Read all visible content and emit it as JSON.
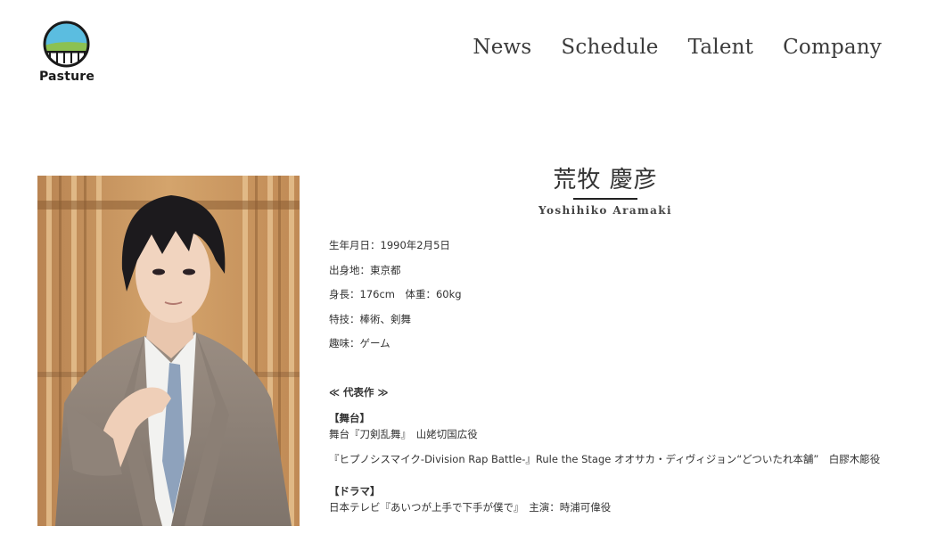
{
  "header": {
    "logo_text": "Pasture",
    "nav": [
      "News",
      "Schedule",
      "Talent",
      "Company"
    ]
  },
  "talent": {
    "name_ja": "荒牧 慶彦",
    "name_en": "Yoshihiko Aramaki"
  },
  "profile": {
    "rows": [
      "生年月日：1990年2月5日",
      "出身地：東京都",
      "身長：176cm　体重：60kg",
      "特技：棒術、剣舞",
      "趣味：ゲーム"
    ]
  },
  "works": {
    "heading": "≪ 代表作 ≫",
    "categories": [
      {
        "title": "【舞台】",
        "items": [
          "舞台『刀剣乱舞』　山姥切国広役",
          "『ヒプノシスマイク-Division Rap Battle-』Rule the Stage オオサカ・ディヴィジョン“どついたれ本舗”　白膠木簓役"
        ]
      },
      {
        "title": "【ドラマ】",
        "items": [
          "日本テレビ『あいつが上手で下手が僕で』　主演：時浦可偉役"
        ]
      }
    ]
  },
  "colors": {
    "logo_sky": "#5bbde0",
    "logo_grass": "#8cc152",
    "logo_ring": "#1a1a1a",
    "text": "#333333",
    "photo_wall": "#c9945a"
  }
}
